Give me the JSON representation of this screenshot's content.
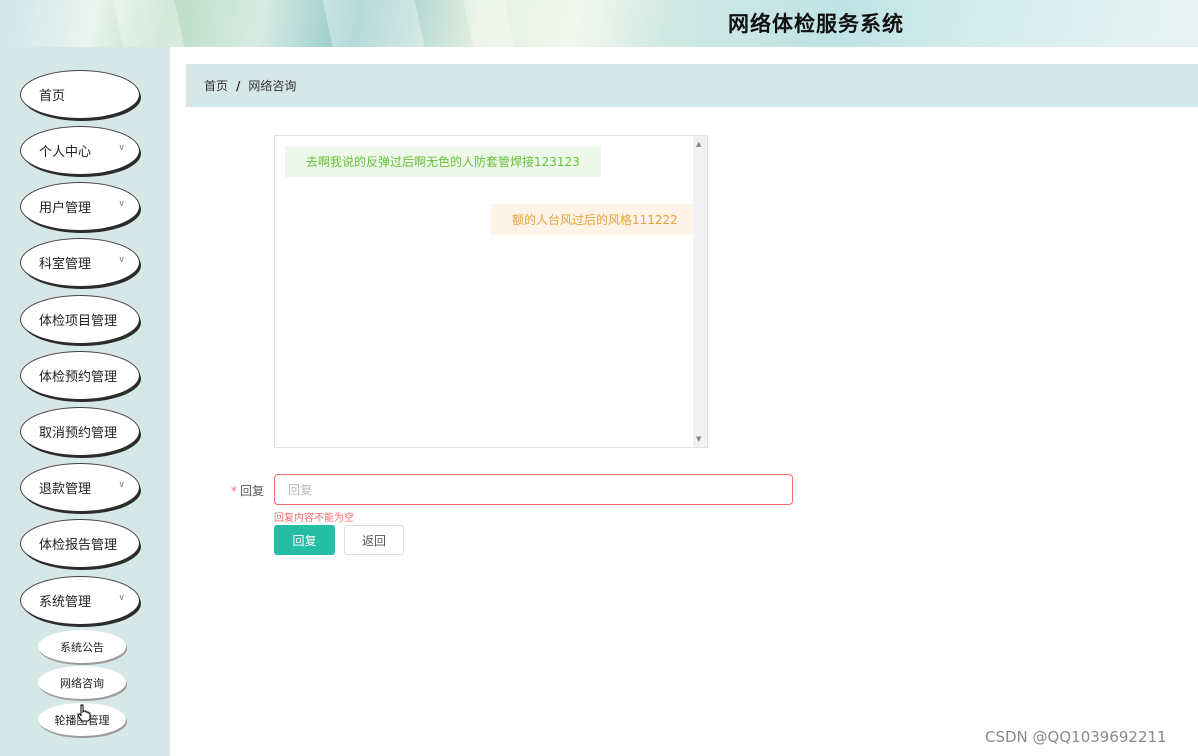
{
  "header": {
    "title": "网络体检服务系统"
  },
  "sidebar": {
    "items": [
      {
        "label": "首页",
        "has_arrow": false
      },
      {
        "label": "个人中心",
        "has_arrow": true
      },
      {
        "label": "用户管理",
        "has_arrow": true
      },
      {
        "label": "科室管理",
        "has_arrow": true
      },
      {
        "label": "体检项目管理",
        "has_arrow": false
      },
      {
        "label": "体检预约管理",
        "has_arrow": false
      },
      {
        "label": "取消预约管理",
        "has_arrow": false
      },
      {
        "label": "退款管理",
        "has_arrow": true
      },
      {
        "label": "体检报告管理",
        "has_arrow": false
      },
      {
        "label": "系统管理",
        "has_arrow": true
      }
    ],
    "sub_items": [
      {
        "label": "系统公告"
      },
      {
        "label": "网络咨询"
      },
      {
        "label": "轮播图管理"
      }
    ]
  },
  "breadcrumb": {
    "home": "首页",
    "separator": "/",
    "current": "网络咨询"
  },
  "chat": {
    "messages": [
      {
        "side": "left",
        "text": "去啊我说的反弹过后啊无色的人防套管焊接123123"
      },
      {
        "side": "right",
        "text": "额的人台风过后的风格111222"
      }
    ]
  },
  "form": {
    "reply_label": "回复",
    "required_mark": "*",
    "reply_value": "",
    "reply_placeholder": "回复",
    "error_message": "回复内容不能为空",
    "submit_label": "回复",
    "back_label": "返回"
  },
  "watermark": "CSDN @QQ1039692211",
  "colors": {
    "accent": "#25bea4",
    "sidebar_bg": "#d6e7e8",
    "error": "#f56c6c"
  }
}
